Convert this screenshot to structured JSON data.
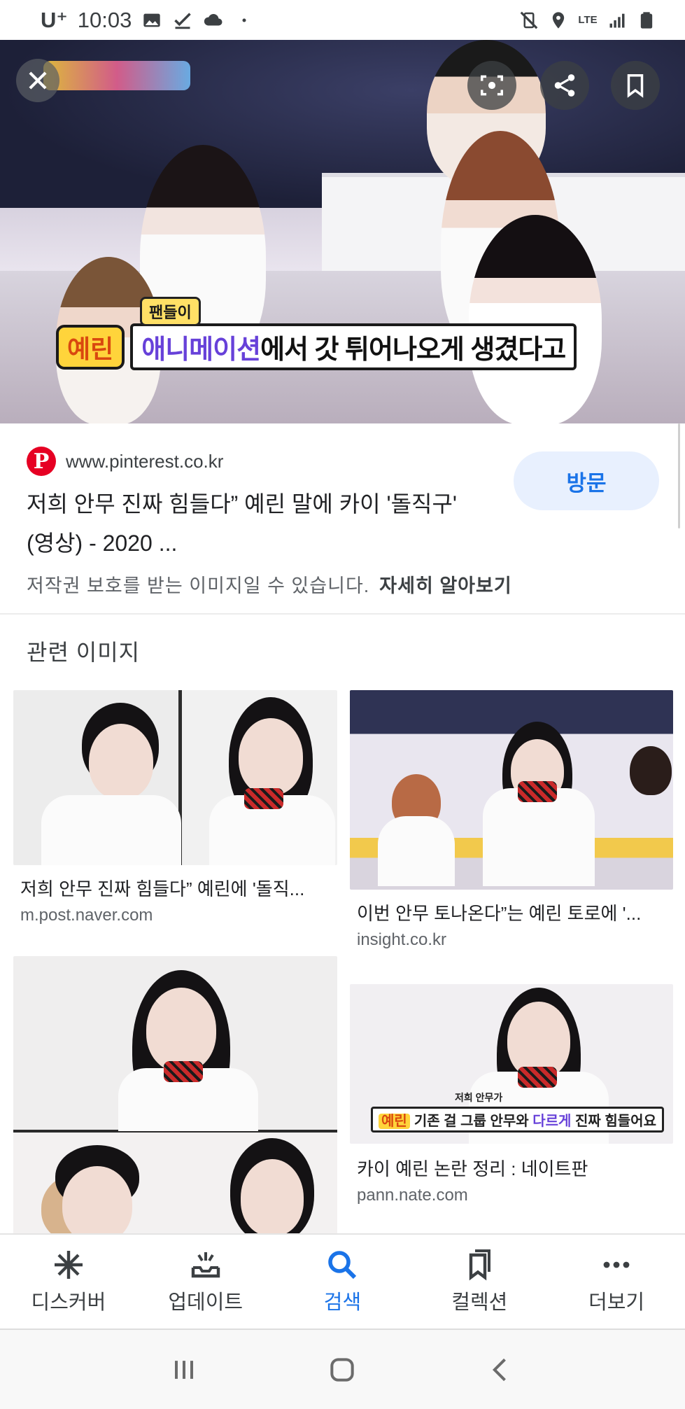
{
  "status_bar": {
    "carrier": "U⁺",
    "time": "10:03",
    "network": "LTE",
    "icons_left": [
      "image-icon",
      "check-icon",
      "cloud-icon",
      "dot-icon"
    ],
    "icons_right": [
      "mute-vibrate-icon",
      "location-icon",
      "lte-icon",
      "signal-icon",
      "battery-icon"
    ]
  },
  "hero": {
    "caption_tag": "팬들이",
    "caption_name": "예린",
    "caption_highlight": "애니메이션",
    "caption_rest": "에서 갓 튀어나오게 생겼다고",
    "buttons": {
      "close": "close-icon",
      "lens": "lens-icon",
      "share": "share-icon",
      "save": "bookmark-icon"
    }
  },
  "result": {
    "source_domain": "www.pinterest.co.kr",
    "source_logo_letter": "P",
    "visit_label": "방문",
    "title": "저희 안무 진짜 힘들다” 예린 말에 카이 '돌직구' (영상) - 2020 ...",
    "copyright_notice": "저작권 보호를 받는 이미지일 수 있습니다.",
    "learn_more": "자세히 알아보기"
  },
  "related": {
    "heading": "관련 이미지",
    "items": [
      {
        "caption": "저희 안무 진짜 힘들다” 예린에 '돌직...",
        "domain": "m.post.naver.com"
      },
      {
        "caption": "이번 안무 토나온다”는 예린 토로에 '...",
        "domain": "insight.co.kr"
      },
      {
        "caption": "",
        "domain": ""
      },
      {
        "caption": "카이 예린 논란 정리 : 네이트판",
        "domain": "pann.nate.com",
        "subtitle_tag": "예린",
        "subtitle_small": "저희 안무가",
        "subtitle_pre": "기존 걸 그룹 안무와 ",
        "subtitle_hl": "다르게",
        "subtitle_post": " 진짜 힘들어요"
      }
    ]
  },
  "bottom_nav": {
    "items": [
      {
        "label": "디스커버",
        "icon": "asterisk-icon",
        "active": false
      },
      {
        "label": "업데이트",
        "icon": "updates-icon",
        "active": false
      },
      {
        "label": "검색",
        "icon": "search-icon",
        "active": true
      },
      {
        "label": "컬렉션",
        "icon": "collections-icon",
        "active": false
      },
      {
        "label": "더보기",
        "icon": "more-icon",
        "active": false
      }
    ]
  },
  "system_nav": [
    "recents-icon",
    "home-icon",
    "back-icon"
  ],
  "colors": {
    "accent": "#1a73e8",
    "visit_bg": "#e8f0fe",
    "pinterest": "#e60023",
    "caption_highlight": "#6741d9"
  }
}
